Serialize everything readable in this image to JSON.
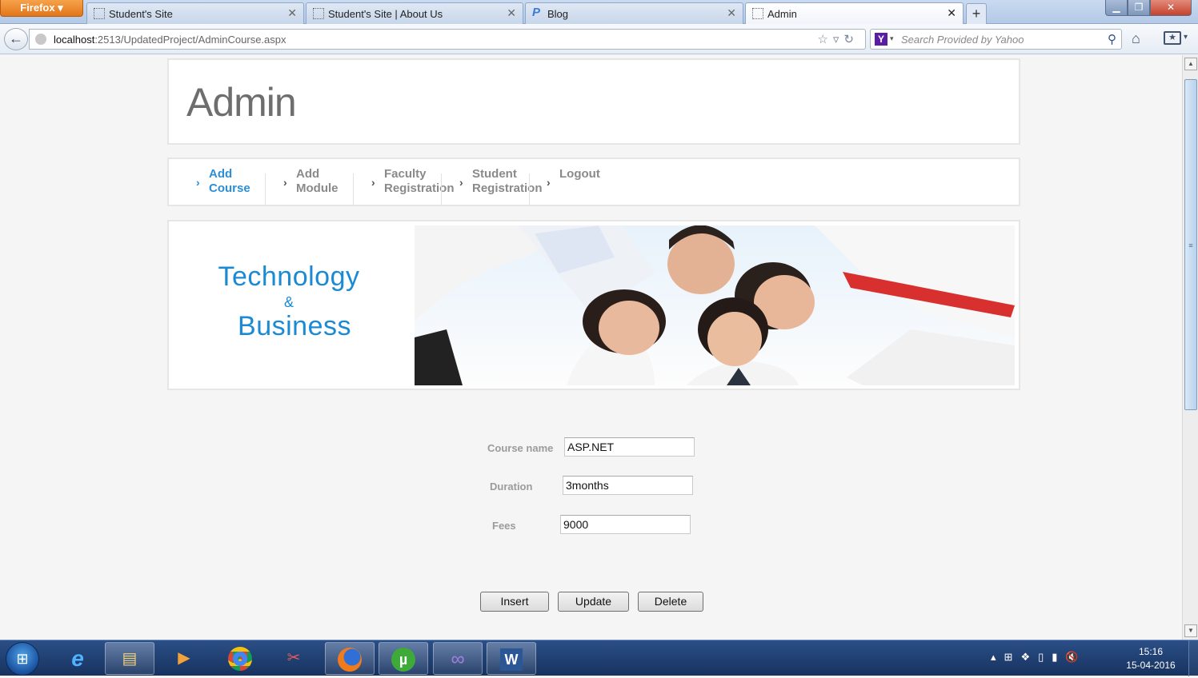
{
  "browser": {
    "app_button": "Firefox",
    "tabs": [
      {
        "label": "Student's Site"
      },
      {
        "label": "Student's Site | About Us"
      },
      {
        "label": "Blog"
      },
      {
        "label": "Admin"
      }
    ],
    "new_tab": "+",
    "url_host": "localhost",
    "url_rest": ":2513/UpdatedProject/AdminCourse.aspx",
    "search_placeholder": "Search Provided by Yahoo",
    "search_engine": "Y"
  },
  "page": {
    "header_title": "Admin",
    "menu": [
      {
        "label": "Add Course",
        "active": true
      },
      {
        "label": "Add Module",
        "active": false
      },
      {
        "label": "Faculty Registration",
        "active": false
      },
      {
        "label": "Student Registration",
        "active": false
      },
      {
        "label": "Logout",
        "active": false
      }
    ],
    "banner": {
      "line1": "Technology",
      "line2": "&",
      "line3": "Business"
    },
    "form": {
      "course_name_label": "Course name",
      "course_name_value": "ASP.NET",
      "duration_label": "Duration",
      "duration_value": "3months",
      "fees_label": "Fees",
      "fees_value": "9000"
    },
    "buttons": {
      "insert": "Insert",
      "update": "Update",
      "delete": "Delete"
    }
  },
  "taskbar": {
    "time": "15:16",
    "date": "15-04-2016"
  },
  "colors": {
    "accent": "#2b8ed6",
    "brand_blue": "#1a8ad4",
    "menu_text": "#8a8a8a",
    "taskbar": "#1e3d70"
  }
}
